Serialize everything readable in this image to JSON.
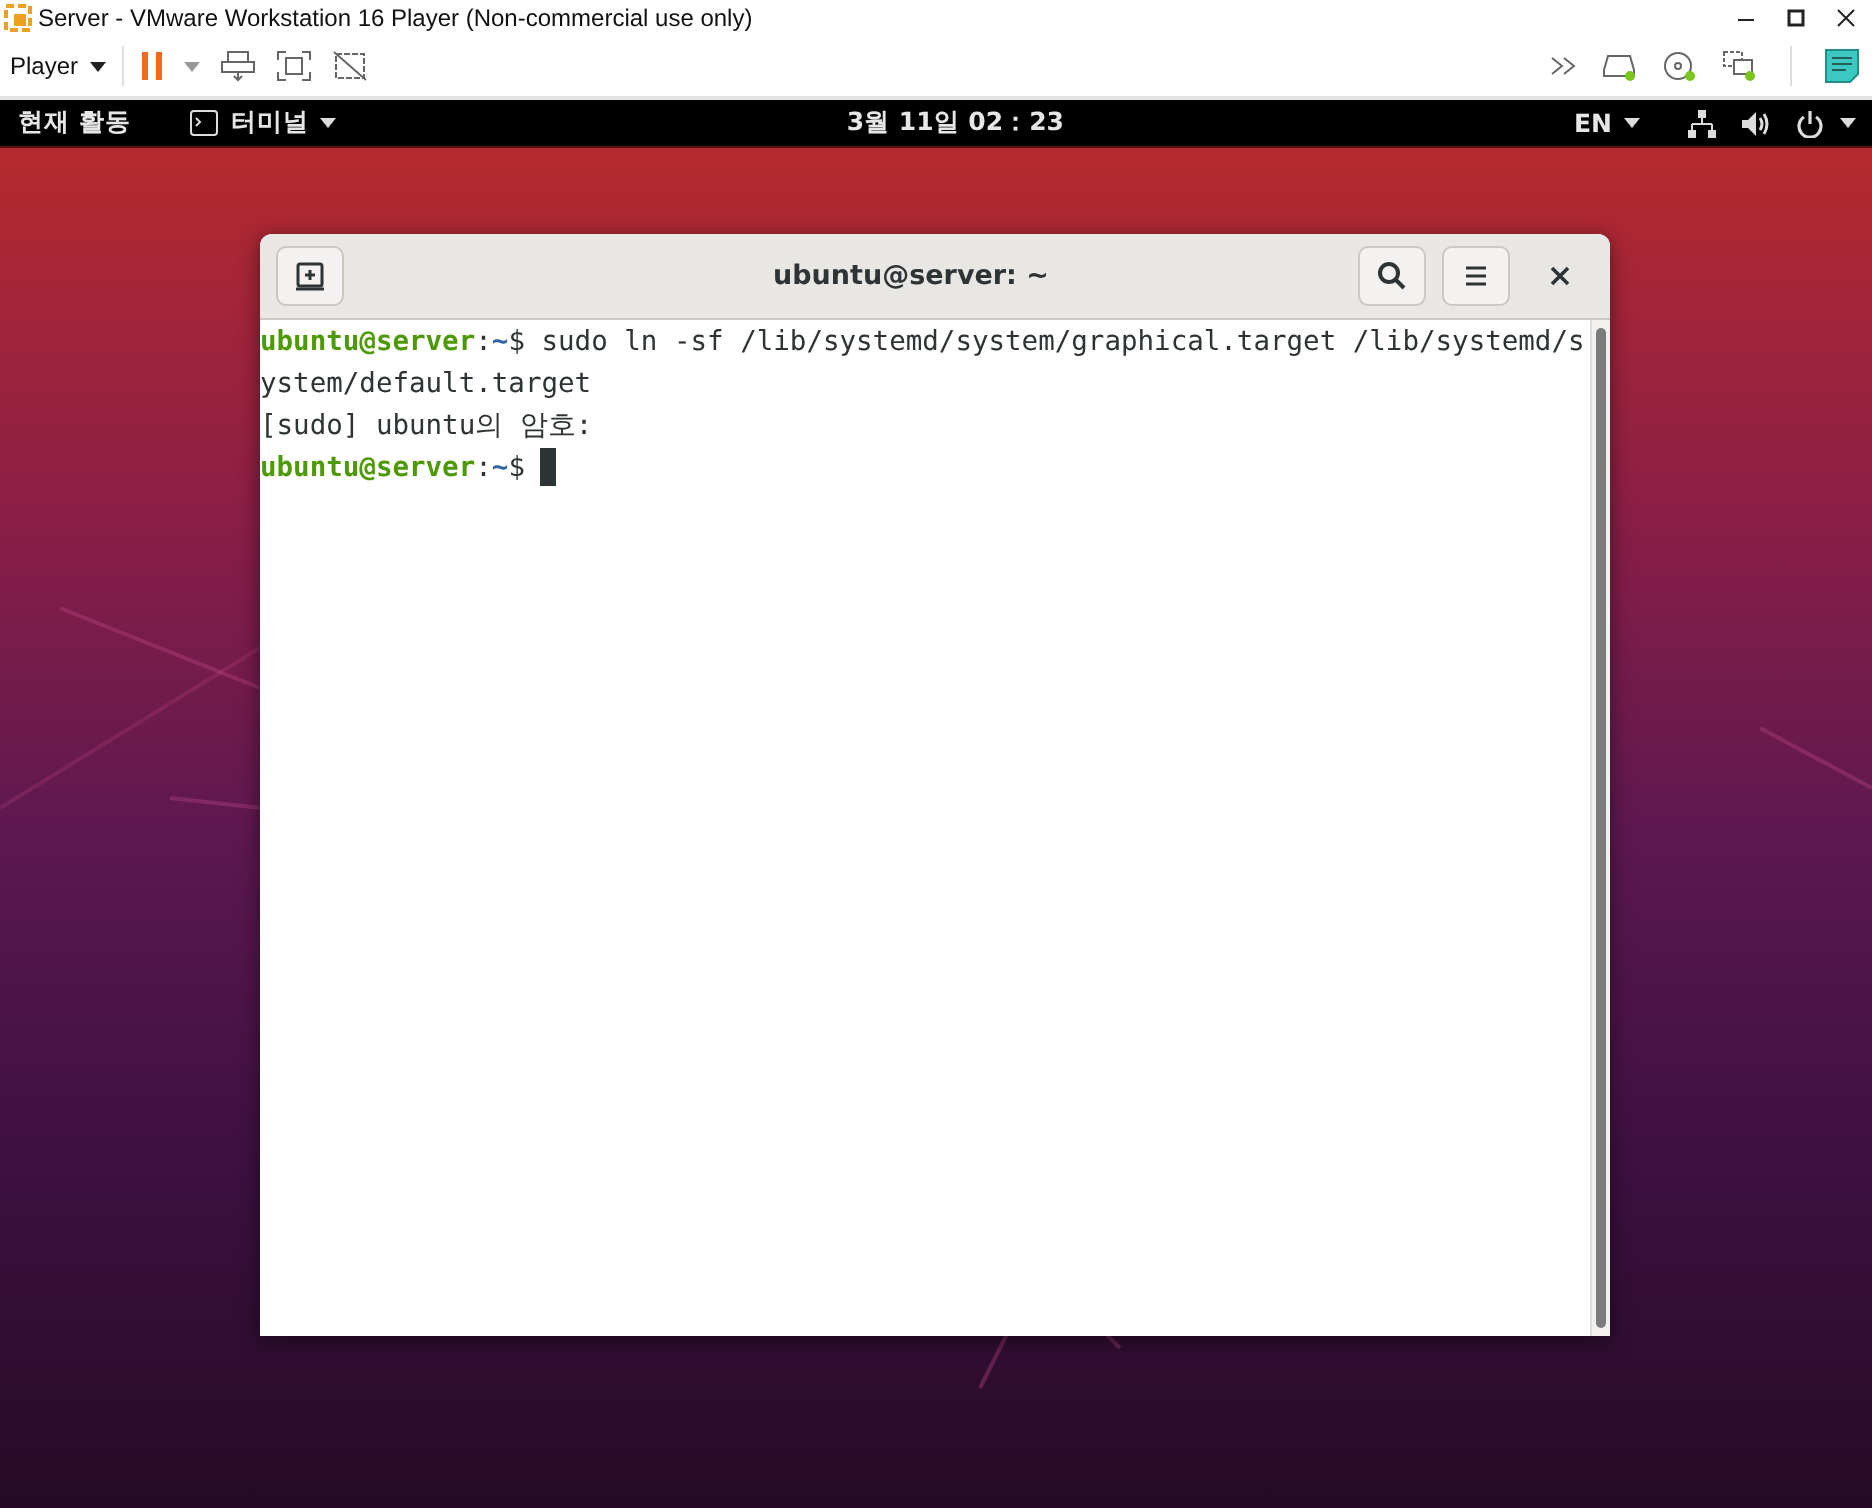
{
  "vm_window": {
    "title": "Server - VMware Workstation 16 Player (Non-commercial use only)"
  },
  "vm_toolbar": {
    "player_menu": "Player"
  },
  "top_bar": {
    "activities": "현재 활동",
    "app_menu": "터미널",
    "clock": "3월 11일 02：23",
    "input_source": "EN"
  },
  "terminal": {
    "title": "ubuntu@server: ~",
    "lines": [
      {
        "kind": "prompt",
        "user": "ubuntu@server",
        "separator": ":",
        "path": "~",
        "text": "$ sudo ln -sf /lib/systemd/system/graphical.target /lib/systemd/s",
        "cursor": false
      },
      {
        "kind": "output",
        "text": "ystem/default.target"
      },
      {
        "kind": "output",
        "text": "[sudo] ubuntu의 암호:"
      },
      {
        "kind": "prompt",
        "user": "ubuntu@server",
        "separator": ":",
        "path": "~",
        "text": "$",
        "cursor": true
      }
    ]
  }
}
